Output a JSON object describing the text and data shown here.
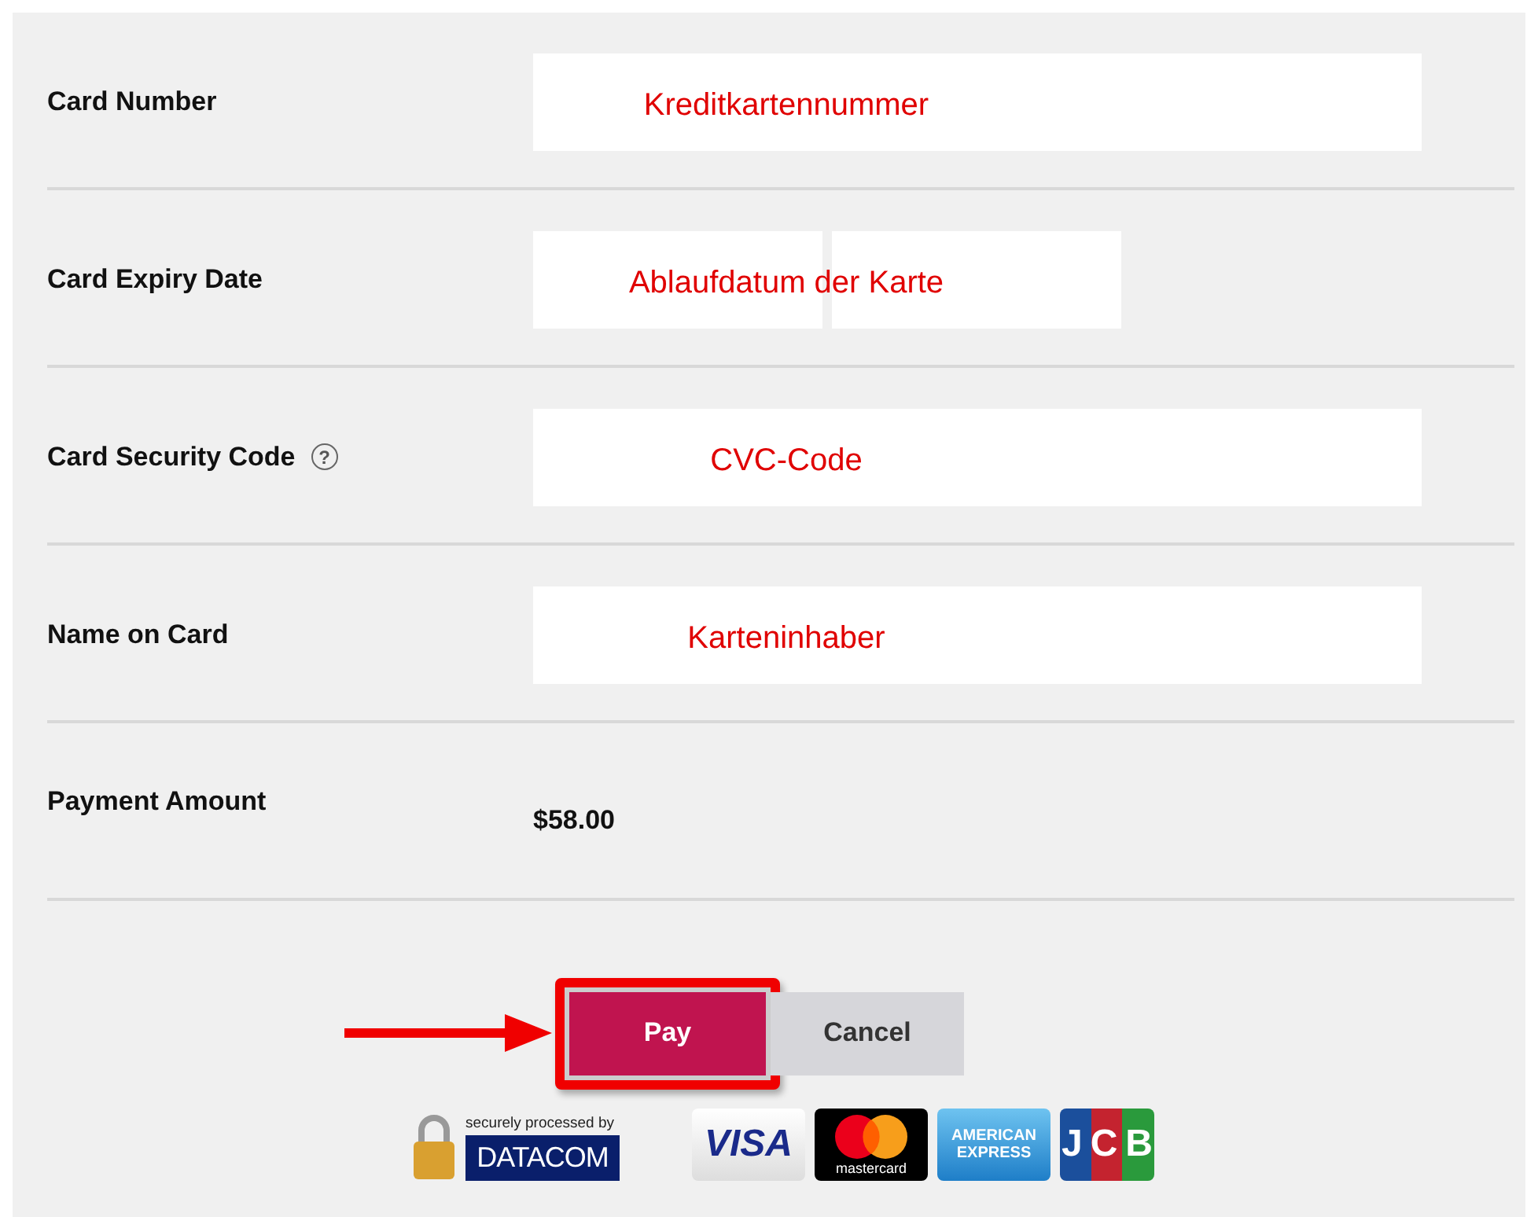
{
  "rows": [
    {
      "kind": "text",
      "label": "Card Number",
      "annotation": "Kreditkartennummer"
    },
    {
      "kind": "expiry",
      "label": "Card Expiry Date",
      "annotation": "Ablaufdatum der Karte"
    },
    {
      "kind": "text",
      "label": "Card Security Code",
      "help": "?",
      "annotation": "CVC-Code"
    },
    {
      "kind": "text",
      "label": "Name on Card",
      "annotation": "Karteninhaber"
    },
    {
      "kind": "amount",
      "label": "Payment Amount",
      "value": "$58.00"
    }
  ],
  "buttons": [
    {
      "kind": "primary",
      "label": "Pay",
      "highlighted": true
    },
    {
      "kind": "secondary",
      "label": "Cancel",
      "highlighted": false
    }
  ],
  "secure_badge": {
    "caption": "securely processed by",
    "brand": "DATACOM"
  },
  "card_logos": [
    {
      "kind": "visa",
      "text": "VISA"
    },
    {
      "kind": "mastercard",
      "text": "mastercard"
    },
    {
      "kind": "amex",
      "text": "AMERICAN EXPRESS"
    },
    {
      "kind": "jcb",
      "text": "JCB"
    }
  ]
}
